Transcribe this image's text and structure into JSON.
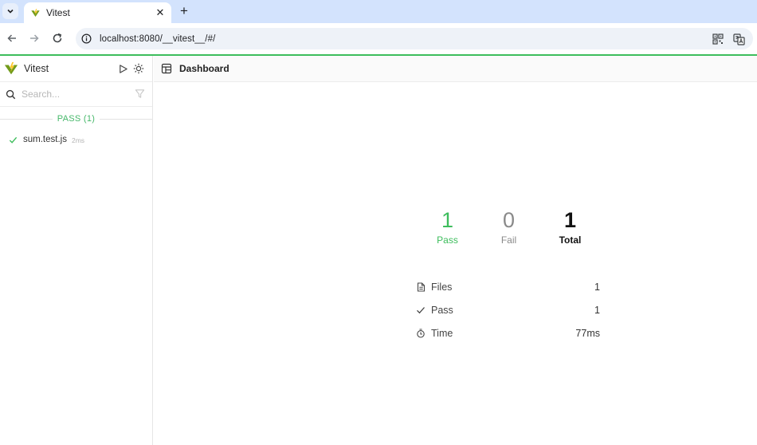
{
  "browser": {
    "tab_title": "Vitest",
    "tab_close": "✕",
    "new_tab": "+",
    "url": "localhost:8080/__vitest__/#/"
  },
  "sidebar": {
    "title": "Vitest",
    "search_placeholder": "Search...",
    "section_label": "PASS (1)",
    "files": [
      {
        "name": "sum.test.js",
        "time": "2ms",
        "status": "pass"
      }
    ]
  },
  "main": {
    "title": "Dashboard",
    "stats": {
      "pass": {
        "value": "1",
        "label": "Pass"
      },
      "fail": {
        "value": "0",
        "label": "Fail"
      },
      "total": {
        "value": "1",
        "label": "Total"
      }
    },
    "summary": [
      {
        "icon": "file-icon",
        "label": "Files",
        "value": "1"
      },
      {
        "icon": "check-icon",
        "label": "Pass",
        "value": "1"
      },
      {
        "icon": "timer-icon",
        "label": "Time",
        "value": "77ms"
      }
    ]
  },
  "colors": {
    "pass": "#3dbd5c",
    "fail": "#8a8a8a",
    "accent_bar": "#3dbd5c",
    "tabstrip": "#d3e3fd"
  }
}
